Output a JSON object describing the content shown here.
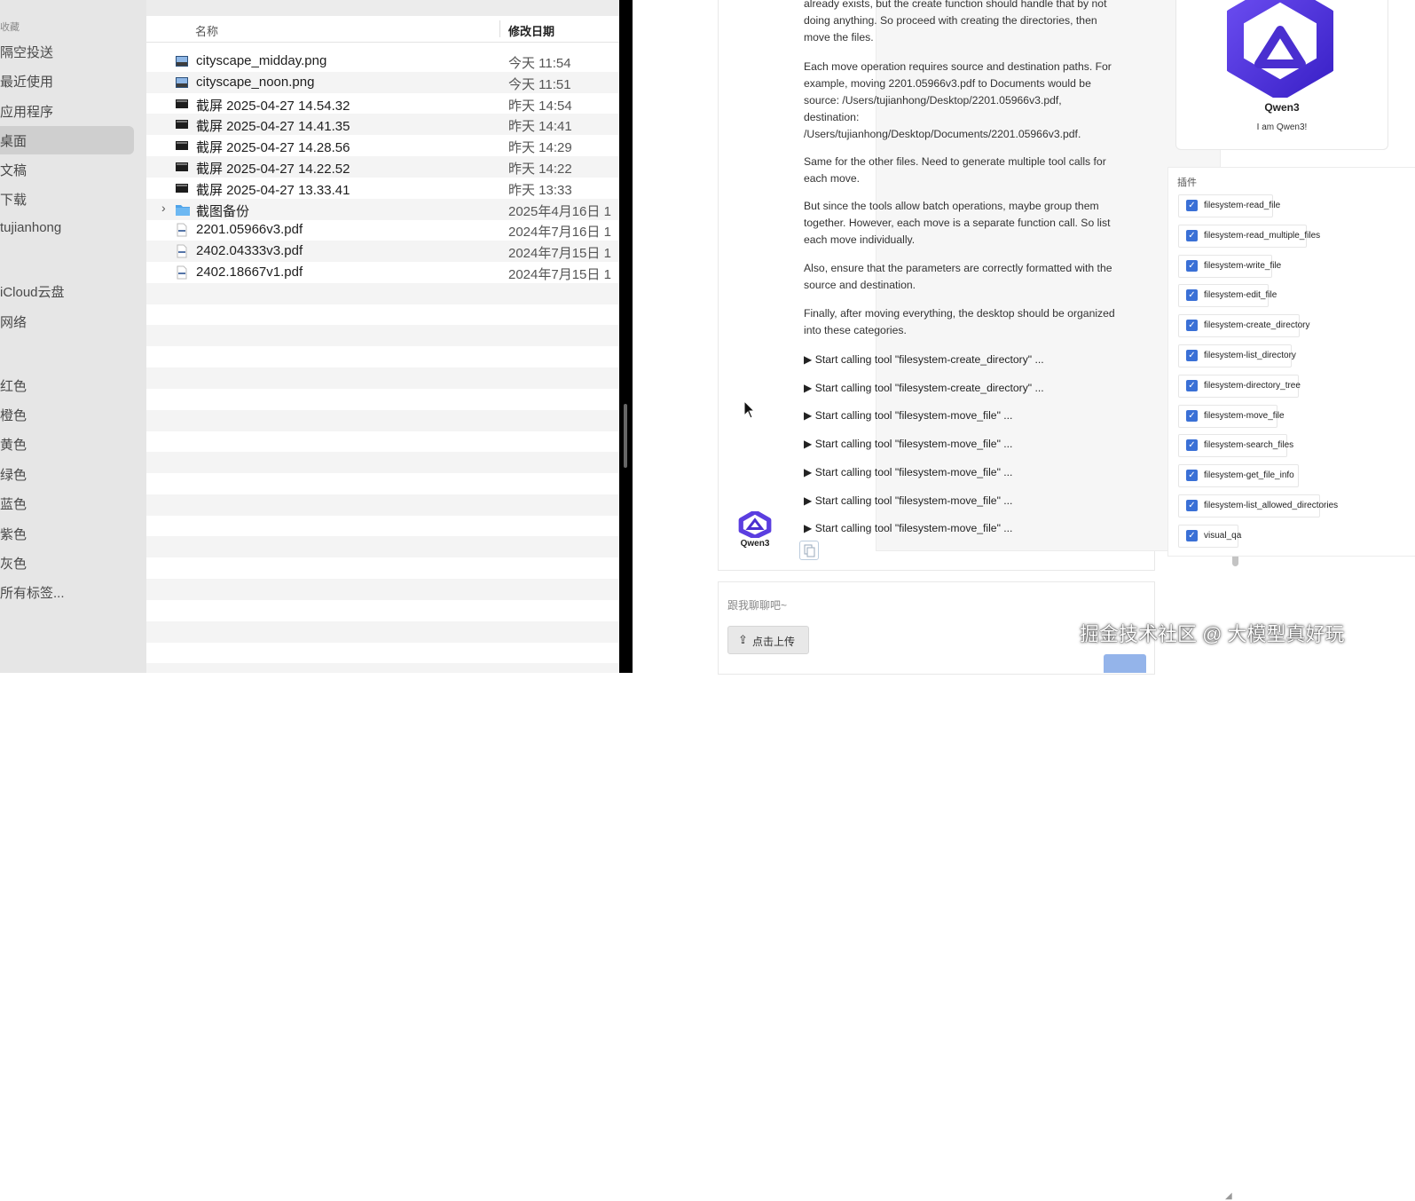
{
  "finder": {
    "sidebar": {
      "favorites_header": "收藏",
      "items": [
        "隔空投送",
        "最近使用",
        "应用程序",
        "桌面",
        "文稿",
        "下载",
        "tujianhong"
      ],
      "selected_index": 3,
      "locations": [
        "iCloud云盘",
        "网络"
      ],
      "tags": [
        "红色",
        "橙色",
        "黄色",
        "绿色",
        "蓝色",
        "紫色",
        "灰色",
        "所有标签..."
      ]
    },
    "columns": {
      "name": "名称",
      "date": "修改日期"
    },
    "files": [
      {
        "name": "cityscape_midday.png",
        "date": "今天 11:54",
        "icon": "image-icon"
      },
      {
        "name": "cityscape_noon.png",
        "date": "今天 11:51",
        "icon": "image-icon"
      },
      {
        "name": "截屏 2025-04-27 14.54.32",
        "date": "昨天 14:54",
        "icon": "screenshot-icon"
      },
      {
        "name": "截屏 2025-04-27 14.41.35",
        "date": "昨天 14:41",
        "icon": "screenshot-icon"
      },
      {
        "name": "截屏 2025-04-27 14.28.56",
        "date": "昨天 14:29",
        "icon": "screenshot-icon"
      },
      {
        "name": "截屏 2025-04-27 14.22.52",
        "date": "昨天 14:22",
        "icon": "screenshot-icon"
      },
      {
        "name": "截屏 2025-04-27 13.33.41",
        "date": "昨天 13:33",
        "icon": "screenshot-icon"
      },
      {
        "name": "截图备份",
        "date": "2025年4月16日 1",
        "icon": "folder-icon"
      },
      {
        "name": "2201.05966v3.pdf",
        "date": "2024年7月16日 1",
        "icon": "pdf-icon"
      },
      {
        "name": "2402.04333v3.pdf",
        "date": "2024年7月15日 1",
        "icon": "pdf-icon"
      },
      {
        "name": "2402.18667v1.pdf",
        "date": "2024年7月15日 1",
        "icon": "pdf-icon"
      }
    ]
  },
  "chat": {
    "paragraphs": [
      "already exists, but the create function should handle that by not doing anything. So proceed with creating the directories, then move the files.",
      "Each move operation requires source and destination paths. For example, moving 2201.05966v3.pdf to Documents would be source: /Users/tujianhong/Desktop/2201.05966v3.pdf, destination: /Users/tujianhong/Desktop/Documents/2201.05966v3.pdf.",
      "Same for the other files. Need to generate multiple tool calls for each move.",
      "But since the tools allow batch operations, maybe group them together. However, each move is a separate function call. So list each move individually.",
      "Also, ensure that the parameters are correctly formatted with the source and destination.",
      "Finally, after moving everything, the desktop should be organized into these categories."
    ],
    "tool_calls": [
      "▶ Start calling tool \"filesystem-create_directory\" ...",
      "▶ Start calling tool \"filesystem-create_directory\" ...",
      "▶ Start calling tool \"filesystem-move_file\" ...",
      "▶ Start calling tool \"filesystem-move_file\" ...",
      "▶ Start calling tool \"filesystem-move_file\" ...",
      "▶ Start calling tool \"filesystem-move_file\" ...",
      "▶ Start calling tool \"filesystem-move_file\" ..."
    ],
    "bot_name": "Qwen3",
    "input_placeholder": "跟我聊聊吧~",
    "upload_label": "点击上传"
  },
  "profile": {
    "name": "Qwen3",
    "greeting": "I am Qwen3!"
  },
  "plugins": {
    "title": "插件",
    "items": [
      {
        "label": "filesystem-read_file",
        "checked": true
      },
      {
        "label": "filesystem-read_multiple_files",
        "checked": true
      },
      {
        "label": "filesystem-write_file",
        "checked": true
      },
      {
        "label": "filesystem-edit_file",
        "checked": true
      },
      {
        "label": "filesystem-create_directory",
        "checked": true
      },
      {
        "label": "filesystem-list_directory",
        "checked": true
      },
      {
        "label": "filesystem-directory_tree",
        "checked": true
      },
      {
        "label": "filesystem-move_file",
        "checked": true
      },
      {
        "label": "filesystem-search_files",
        "checked": true
      },
      {
        "label": "filesystem-get_file_info",
        "checked": true
      },
      {
        "label": "filesystem-list_allowed_directories",
        "checked": true
      },
      {
        "label": "visual_qa",
        "checked": true
      }
    ]
  },
  "watermark": "掘金技术社区 @ 大模型真好玩",
  "colors": {
    "accent": "#3a70d6",
    "logo": "#5b3ee0",
    "selection": "#cfcfcf"
  }
}
